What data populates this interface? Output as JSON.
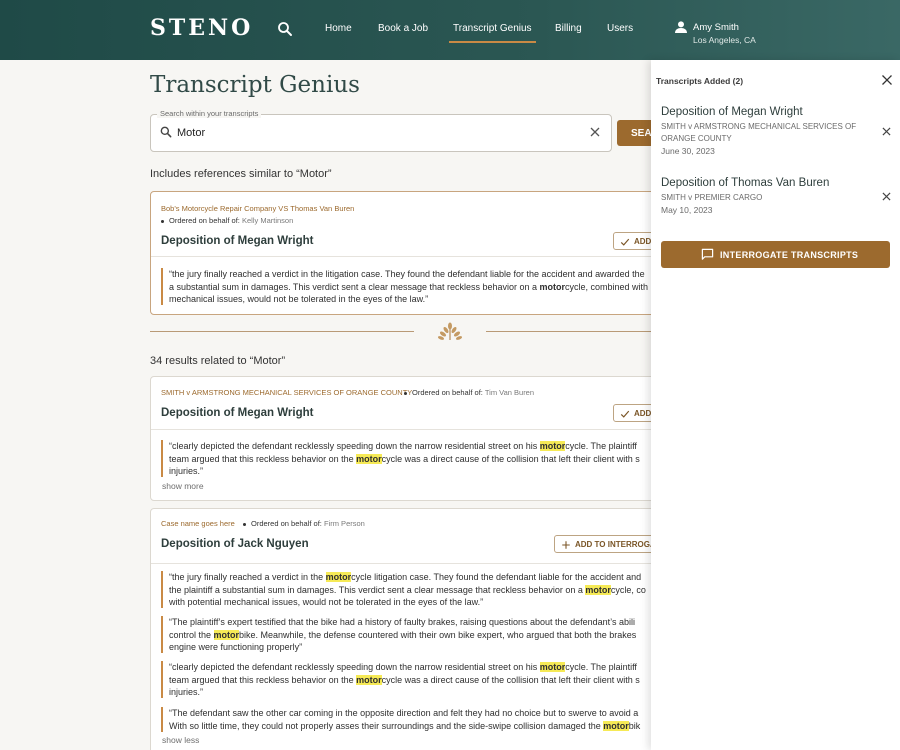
{
  "nav": {
    "logo": "STENO",
    "links": [
      "Home",
      "Book a Job",
      "Transcript Genius",
      "Billing",
      "Users"
    ],
    "active": "Transcript Genius",
    "user_name": "Amy Smith",
    "user_location": "Los Angeles, CA",
    "icons": {
      "search": "search-icon",
      "user": "user-icon"
    }
  },
  "main": {
    "title": "Transcript Genius",
    "search": {
      "label": "Search within your transcripts",
      "value": "Motor",
      "button": "SEAR"
    },
    "includes_text": "Includes references similar to “Motor”",
    "featured": {
      "case": "Bob's Motorcycle Repair Company VS Thomas Van Buren",
      "ordered_label": "Ordered on behalf of:",
      "ordered_by": "Kelly Martinson",
      "title": "Deposition of Megan Wright",
      "add_label": "ADD",
      "quote": {
        "l1": "“the jury finally reached a verdict in the litigation case. They found the defendant liable for the accident and awarded the",
        "l2a": "a substantial sum in damages. This verdict sent a clear message that reckless behavior on a ",
        "l2b": "motor",
        "l2c": "cycle, combined with",
        "l3": "mechanical issues, would not be tolerated in the eyes of the law.”"
      }
    },
    "results_count": "34 results related to “Motor”",
    "result1": {
      "case": "SMITH v ARMSTRONG MECHANICAL SERVICES OF ORANGE COUNTY",
      "ordered_label": "Ordered on behalf of:",
      "ordered_by": "Tim Van Buren",
      "title": "Deposition of Megan Wright",
      "add_label": "ADD",
      "quote": {
        "l1a": "“clearly depicted the defendant recklessly speeding down the narrow residential street on his ",
        "l1b": "motor",
        "l1c": "cycle. The plaintiff",
        "l2a": "team argued that this reckless behavior on the ",
        "l2b": "motor",
        "l2c": "cycle was a direct cause of the collision that left their client with s",
        "l3": "injuries.”"
      },
      "show_more": "show more"
    },
    "result2": {
      "case": "Case name goes here",
      "ordered_label": "Ordered on behalf of:",
      "ordered_by": "Firm Person",
      "title": "Deposition of Jack Nguyen",
      "add_label": "ADD TO INTERROGA",
      "quotes": {
        "q1": {
          "l1a": "“the jury finally reached a verdict in the ",
          "l1b": "motor",
          "l1c": "cycle litigation case. They found the defendant liable for the accident and",
          "l2a": "the plaintiff a substantial sum in damages. This verdict sent a clear message that reckless behavior on a ",
          "l2b": "motor",
          "l2c": "cycle, co",
          "l3": "with potential mechanical issues, would not be tolerated in the eyes of the law.”"
        },
        "q2": {
          "l1": "“The plaintiff’s expert testified that the bike had a history of faulty brakes, raising questions about the defendant’s abili",
          "l2a": "control the ",
          "l2b": "motor",
          "l2c": "bike. Meanwhile, the defense countered with their own bike expert, who argued that both the brakes",
          "l3": "engine were functioning properly”"
        },
        "q3": {
          "l1a": "“clearly depicted the defendant recklessly speeding down the narrow residential street on his ",
          "l1b": "motor",
          "l1c": "cycle. The plaintiff",
          "l2a": "team argued that this reckless behavior on the ",
          "l2b": "motor",
          "l2c": "cycle was a direct cause of the collision that left their client with s",
          "l3": "injuries.”"
        },
        "q4": {
          "l1": "“The defendant saw the other car coming in the opposite direction and felt they had no choice but to swerve to avoid a",
          "l2a": "With so little time, they could not properly asses their surroundings and the side-swipe collision damaged the ",
          "l2b": "motor",
          "l2c": "bik"
        }
      },
      "show_less": "show less"
    }
  },
  "panel": {
    "heading": "Transcripts Added (2)",
    "items": [
      {
        "title": "Deposition of Megan Wright",
        "case": "SMITH v ARMSTRONG MECHANICAL SERVICES OF ORANGE COUNTY",
        "date": "June 30, 2023"
      },
      {
        "title": "Deposition of Thomas Van Buren",
        "case": "SMITH v PREMIER CARGO",
        "date": "May 10, 2023"
      }
    ],
    "button": "INTERROGATE TRANSCRIPTS"
  },
  "colors": {
    "header": "#2b5753",
    "accent": "#9c6a2e",
    "highlight": "#f6ea56"
  }
}
